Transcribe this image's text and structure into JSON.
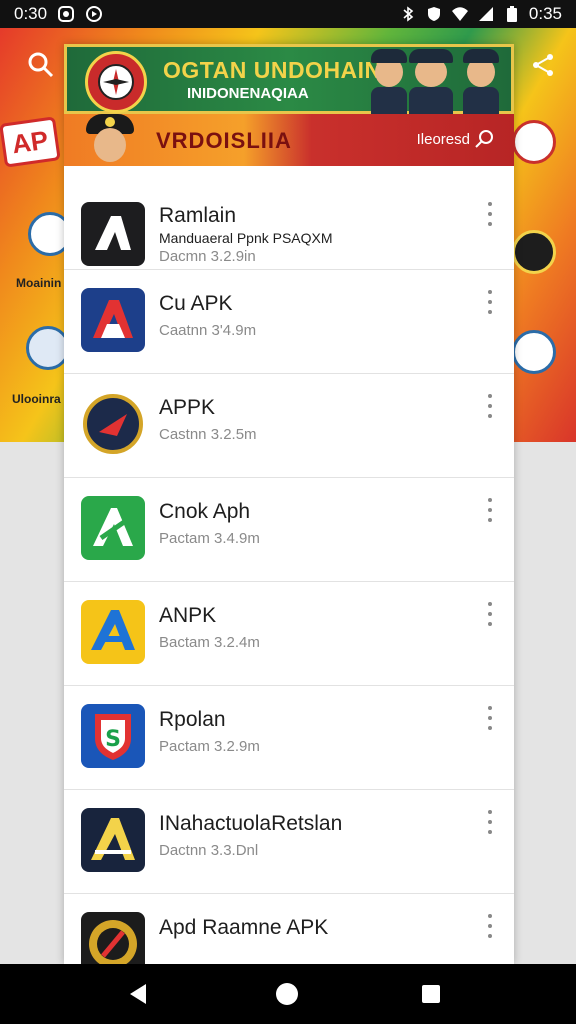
{
  "status_bar": {
    "time_left": "0:30",
    "time_right": "0:35",
    "left_icons": [
      "notification-icon",
      "media-icon"
    ],
    "right_icons": [
      "bluetooth-icon",
      "shield-icon",
      "wifi-icon",
      "signal-icon",
      "battery-icon"
    ]
  },
  "background": {
    "ap_badge": "AP",
    "left_label_1": "Moainin",
    "left_label_2": "Ulooinra"
  },
  "header": {
    "title": "OGTAN UNDOHAIN",
    "subtitle": "INIDONENAQIAA",
    "second_title": "VRDOISLIIA",
    "second_right": "Ileoresd",
    "colors": {
      "green": "#2b8a45",
      "gold": "#f3d34a",
      "orange": "#f07b24",
      "red": "#c9302c"
    }
  },
  "apps": [
    {
      "name": "Ramlain",
      "subtitle": "Manduaeral Ppnk PSAQXM",
      "detail": "Dacmn 3.2.9in",
      "icon": "a-white-app-icon"
    },
    {
      "name": "Cu APK",
      "detail": "Caatnn 3'4.9m",
      "icon": "red-a-app-icon"
    },
    {
      "name": "APPK",
      "detail": "Castnn 3.2.5m",
      "icon": "badge-app-icon"
    },
    {
      "name": "Cnok Aph",
      "detail": "Pactam 3.4.9m",
      "icon": "green-a-app-icon"
    },
    {
      "name": "ANPK",
      "detail": "Bactam 3.2.4m",
      "icon": "yellow-a-app-icon"
    },
    {
      "name": "Rpolan",
      "detail": "Pactam 3.2.9m",
      "icon": "shield-s-app-icon"
    },
    {
      "name": "INahactuolaRetslan",
      "detail": "Dactnn 3.3.Dnl",
      "icon": "dark-a-app-icon"
    },
    {
      "name": "Apd Raamne APK",
      "detail": "",
      "icon": "gear-app-icon"
    }
  ],
  "nav": {
    "icons": [
      "back-icon",
      "home-icon",
      "recents-icon"
    ]
  }
}
